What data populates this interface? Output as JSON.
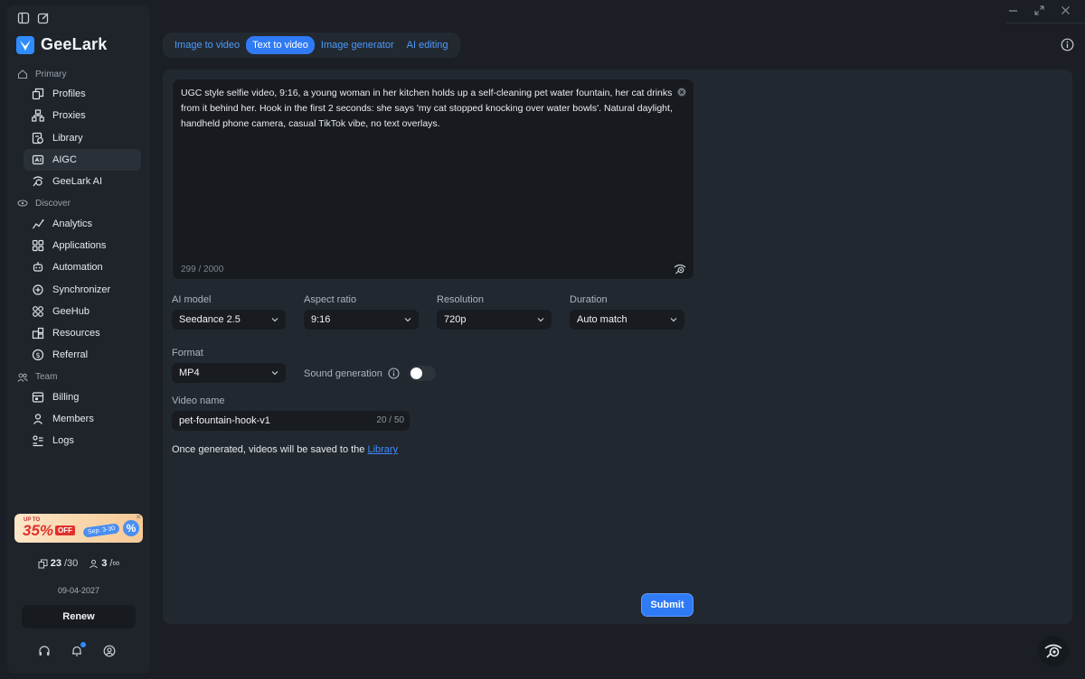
{
  "app": {
    "name": "GeeLark",
    "brand_color": "#2f7af5"
  },
  "sidebar": {
    "sections": [
      {
        "label": "Primary",
        "icon": "home-icon",
        "items": [
          {
            "label": "Profiles",
            "icon": "profiles-icon"
          },
          {
            "label": "Proxies",
            "icon": "proxies-icon"
          },
          {
            "label": "Library",
            "icon": "library-icon"
          },
          {
            "label": "AIGC",
            "icon": "aigc-icon",
            "active": true
          },
          {
            "label": "GeeLark AI",
            "icon": "geelark-ai-icon"
          }
        ]
      },
      {
        "label": "Discover",
        "icon": "discover-icon",
        "items": [
          {
            "label": "Analytics",
            "icon": "analytics-icon"
          },
          {
            "label": "Applications",
            "icon": "applications-icon"
          },
          {
            "label": "Automation",
            "icon": "automation-icon"
          },
          {
            "label": "Synchronizer",
            "icon": "synchronizer-icon"
          },
          {
            "label": "GeeHub",
            "icon": "geehub-icon"
          },
          {
            "label": "Resources",
            "icon": "resources-icon"
          },
          {
            "label": "Referral",
            "icon": "referral-icon"
          }
        ]
      },
      {
        "label": "Team",
        "icon": "team-icon",
        "items": [
          {
            "label": "Billing",
            "icon": "billing-icon"
          },
          {
            "label": "Members",
            "icon": "members-icon"
          },
          {
            "label": "Logs",
            "icon": "logs-icon"
          }
        ]
      }
    ],
    "promo": {
      "up_to": "UP TO",
      "percent": "35%",
      "off": "OFF",
      "dates": "Sep. 3-30",
      "badge": "%"
    },
    "stats": {
      "profiles_used": "23",
      "profiles_total": "/30",
      "members_used": "3",
      "members_total": "/∞"
    },
    "expiry_date": "09-04-2027",
    "renew_label": "Renew"
  },
  "tabs": [
    {
      "label": "Image to video",
      "active": false
    },
    {
      "label": "Text to video",
      "active": true
    },
    {
      "label": "Image generator",
      "active": false
    },
    {
      "label": "AI editing",
      "active": false
    }
  ],
  "form": {
    "prompt_text": "UGC style selfie video, 9:16, a young woman in her kitchen holds up a self-cleaning pet water fountain, her cat drinks from it behind her. Hook in the first 2 seconds: she says 'my cat stopped knocking over water bowls'. Natural daylight, handheld phone camera, casual TikTok vibe, no text overlays.",
    "prompt_counter": "299 / 2000",
    "ai_model": {
      "label": "AI model",
      "value": "Seedance 2.5"
    },
    "aspect_ratio": {
      "label": "Aspect ratio",
      "value": "9:16"
    },
    "resolution": {
      "label": "Resolution",
      "value": "720p"
    },
    "duration": {
      "label": "Duration",
      "value": "Auto match"
    },
    "format": {
      "label": "Format",
      "value": "MP4"
    },
    "sound_generation": {
      "label": "Sound generation",
      "enabled": false
    },
    "video_name": {
      "label": "Video name",
      "value": "pet-fountain-hook-v1",
      "counter": "20 / 50"
    },
    "saved_note_prefix": "Once generated, videos will be saved to the ",
    "saved_note_link": "Library",
    "submit_label": "Submit"
  }
}
